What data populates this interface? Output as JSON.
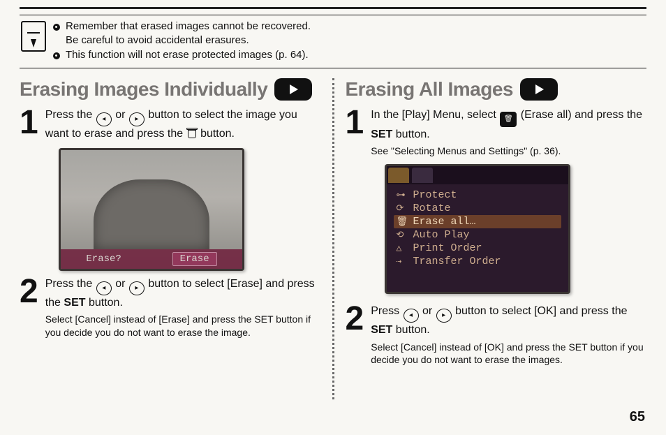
{
  "note": {
    "line1": "Remember that erased images cannot be recovered.",
    "line1b": "Be careful to avoid accidental erasures.",
    "line2": "This function will not erase protected images (p. 64)."
  },
  "left": {
    "title": "Erasing Images Individually",
    "step1": {
      "pre": "Press the ",
      "mid": " or ",
      "post": " button to select the image you want to erase and press the ",
      "tail": " button."
    },
    "thumb": {
      "label1": "Erase?",
      "label2": "Erase"
    },
    "step2": {
      "main_pre": "Press the ",
      "main_mid": " or ",
      "main_post": " button to select [Erase] and press the ",
      "set": "SET",
      "main_tail": " button.",
      "sub": "Select [Cancel] instead of [Erase] and press the SET button if you decide you do not want to erase the image."
    }
  },
  "right": {
    "title": "Erasing All Images",
    "step1": {
      "pre": "In the [Play] Menu, select ",
      "post": " (Erase all) and press the ",
      "set": "SET",
      "tail": " button.",
      "sub": "See \"Selecting Menus and Settings\" (p. 36)."
    },
    "menu": {
      "items": [
        {
          "icon": "⊶",
          "label": "Protect"
        },
        {
          "icon": "⟳",
          "label": "Rotate"
        },
        {
          "icon": "🗑",
          "label": "Erase all…",
          "selected": true
        },
        {
          "icon": "⟲",
          "label": "Auto Play"
        },
        {
          "icon": "△",
          "label": "Print Order"
        },
        {
          "icon": "⇢",
          "label": "Transfer Order"
        }
      ]
    },
    "step2": {
      "main_pre": "Press ",
      "main_mid": " or ",
      "main_post": " button to select [OK] and press the ",
      "set": "SET",
      "main_tail": " button.",
      "sub": "Select [Cancel] instead of [OK] and press the SET button if you decide you do not want to erase the images."
    }
  },
  "page_number": "65"
}
